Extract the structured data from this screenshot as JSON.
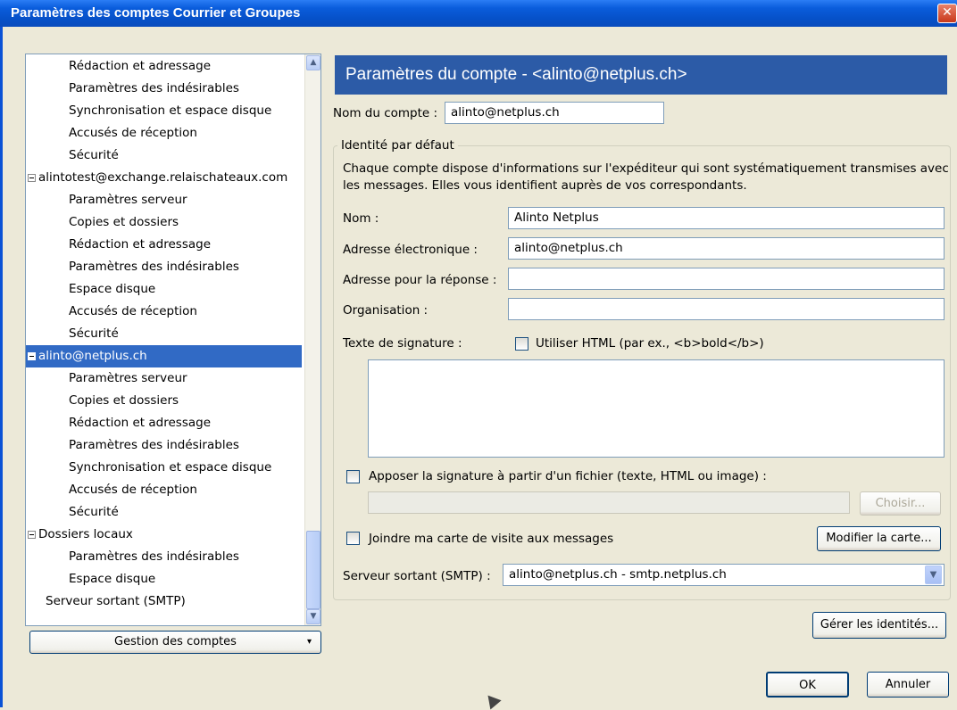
{
  "window": {
    "title": "Paramètres des comptes Courrier et Groupes"
  },
  "tree": {
    "items": [
      {
        "label": "Rédaction et adressage",
        "level": 2,
        "selected": false
      },
      {
        "label": "Paramètres des indésirables",
        "level": 2,
        "selected": false
      },
      {
        "label": "Synchronisation et espace disque",
        "level": 2,
        "selected": false
      },
      {
        "label": "Accusés de réception",
        "level": 2,
        "selected": false
      },
      {
        "label": "Sécurité",
        "level": 2,
        "selected": false
      },
      {
        "label": "alintotest@exchange.relaischateaux.com",
        "level": 1,
        "selected": false
      },
      {
        "label": "Paramètres serveur",
        "level": 2,
        "selected": false
      },
      {
        "label": "Copies et dossiers",
        "level": 2,
        "selected": false
      },
      {
        "label": "Rédaction et adressage",
        "level": 2,
        "selected": false
      },
      {
        "label": "Paramètres des indésirables",
        "level": 2,
        "selected": false
      },
      {
        "label": "Espace disque",
        "level": 2,
        "selected": false
      },
      {
        "label": "Accusés de réception",
        "level": 2,
        "selected": false
      },
      {
        "label": "Sécurité",
        "level": 2,
        "selected": false
      },
      {
        "label": "alinto@netplus.ch",
        "level": 1,
        "selected": true
      },
      {
        "label": "Paramètres serveur",
        "level": 2,
        "selected": false
      },
      {
        "label": "Copies et dossiers",
        "level": 2,
        "selected": false
      },
      {
        "label": "Rédaction et adressage",
        "level": 2,
        "selected": false
      },
      {
        "label": "Paramètres des indésirables",
        "level": 2,
        "selected": false
      },
      {
        "label": "Synchronisation et espace disque",
        "level": 2,
        "selected": false
      },
      {
        "label": "Accusés de réception",
        "level": 2,
        "selected": false
      },
      {
        "label": "Sécurité",
        "level": 2,
        "selected": false
      },
      {
        "label": "Dossiers locaux",
        "level": 1,
        "selected": false
      },
      {
        "label": "Paramètres des indésirables",
        "level": 2,
        "selected": false
      },
      {
        "label": "Espace disque",
        "level": 2,
        "selected": false
      },
      {
        "label": "Serveur sortant (SMTP)",
        "level": 0,
        "selected": false
      }
    ],
    "manage_button": "Gestion des comptes",
    "manage_arrow": "▾"
  },
  "panel": {
    "header": "Paramètres du compte - <alinto@netplus.ch>",
    "account_name_label": "Nom du compte :",
    "account_name_value": "alinto@netplus.ch",
    "identity_legend": "Identité par défaut",
    "identity_desc_1": "Chaque compte dispose d'informations sur l'expéditeur qui sont systématiquement transmises avec",
    "identity_desc_2": "les messages. Elles vous identifient auprès de vos correspondants.",
    "name_label": "Nom :",
    "name_value": "Alinto Netplus",
    "email_label": "Adresse électronique :",
    "email_value": "alinto@netplus.ch",
    "reply_label": "Adresse pour la réponse :",
    "reply_value": "",
    "org_label": "Organisation :",
    "org_value": "",
    "signature_label": "Texte de signature :",
    "use_html_label": "Utiliser HTML (par ex., <b>bold</b>)",
    "use_html_checked": false,
    "signature_text": "",
    "attach_sig_label": "Apposer la signature à partir d'un fichier (texte, HTML ou image) :",
    "attach_sig_checked": false,
    "sig_file_value": "",
    "choose_button": "Choisir...",
    "vcard_label": "Joindre ma carte de visite aux messages",
    "vcard_checked": false,
    "edit_card_button": "Modifier la carte...",
    "smtp_label": "Serveur sortant (SMTP) :",
    "smtp_value": "alinto@netplus.ch - smtp.netplus.ch",
    "manage_identities_button": "Gérer les identités..."
  },
  "footer": {
    "ok": "OK",
    "cancel": "Annuler"
  },
  "icons": {
    "close": "close-icon",
    "scroll_up": "scroll-up-arrow-icon",
    "scroll_down": "scroll-down-arrow-icon",
    "dropdown": "chevron-down-icon"
  },
  "colors": {
    "titlebar": "#0a5ddc",
    "header": "#2c5ba7",
    "selection": "#316ac5",
    "background": "#ece9d8"
  }
}
